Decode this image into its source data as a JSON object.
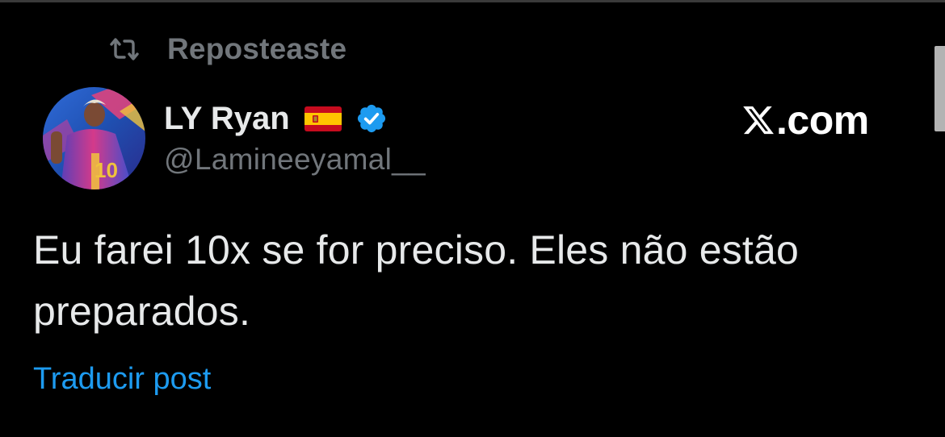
{
  "repost": {
    "icon": "repost-icon",
    "label": "Reposteaste"
  },
  "author": {
    "display_name": "LY Ryan",
    "flag_icon": "spain-flag-icon",
    "verified_icon": "verified-badge-icon",
    "handle": "@Lamineeyamal__"
  },
  "brand": {
    "icon": "x-logo-icon",
    "text": ".com"
  },
  "post": {
    "text": "Eu farei 10x se for preciso. Eles não estão preparados."
  },
  "translate": {
    "label": "Traducir post"
  },
  "colors": {
    "background": "#000000",
    "primary_text": "#e7e9ea",
    "secondary_text": "#71767b",
    "link": "#1d9bf0",
    "verified": "#1d9bf0"
  }
}
